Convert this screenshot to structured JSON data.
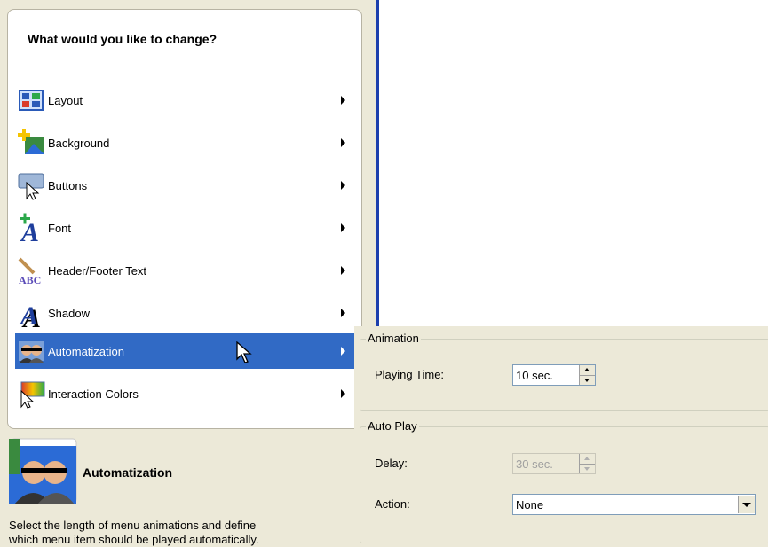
{
  "menu": {
    "title": "What would you like to change?",
    "items": [
      {
        "label": "Layout",
        "icon": "layout-icon"
      },
      {
        "label": "Background",
        "icon": "background-icon"
      },
      {
        "label": "Buttons",
        "icon": "buttons-icon"
      },
      {
        "label": "Font",
        "icon": "font-icon"
      },
      {
        "label": "Header/Footer Text",
        "icon": "header-footer-text-icon"
      },
      {
        "label": "Shadow",
        "icon": "shadow-icon"
      },
      {
        "label": "Automatization",
        "icon": "automatization-icon",
        "selected": true
      },
      {
        "label": "Interaction Colors",
        "icon": "interaction-colors-icon"
      }
    ]
  },
  "info": {
    "title": "Automatization",
    "description_line1": "Select the length of menu animations and define",
    "description_line2": "which menu item should be played automatically."
  },
  "settings": {
    "animation": {
      "legend": "Animation",
      "playing_time_label": "Playing Time:",
      "playing_time_value": "10 sec."
    },
    "auto_play": {
      "legend": "Auto Play",
      "delay_label": "Delay:",
      "delay_value": "30 sec.",
      "action_label": "Action:",
      "action_value": "None"
    }
  },
  "colors": {
    "selection": "#316ac5",
    "divider": "#1c3fae",
    "panel_bg": "#ece9d8"
  }
}
